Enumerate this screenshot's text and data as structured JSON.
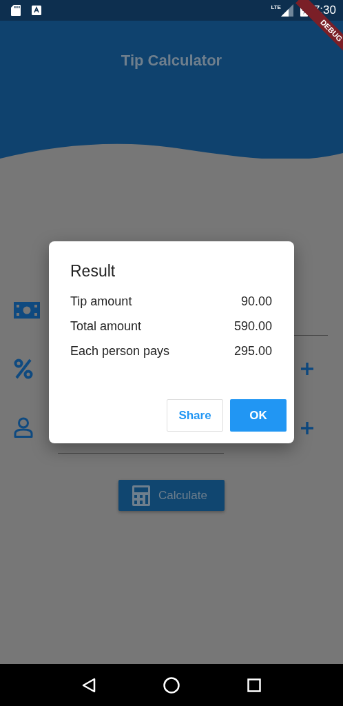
{
  "status_bar": {
    "network": "LTE",
    "time": "7:30"
  },
  "debug_banner": "DEBUG",
  "app_bar": {
    "title": "Tip Calculator"
  },
  "form": {
    "calculate_button": "Calculate"
  },
  "dialog": {
    "title": "Result",
    "rows": [
      {
        "label": "Tip amount",
        "value": "90.00"
      },
      {
        "label": "Total amount",
        "value": "590.00"
      },
      {
        "label": "Each person pays",
        "value": "295.00"
      }
    ],
    "buttons": [
      {
        "label": "Share",
        "kind": "outlined"
      },
      {
        "label": "OK",
        "kind": "filled"
      }
    ]
  }
}
